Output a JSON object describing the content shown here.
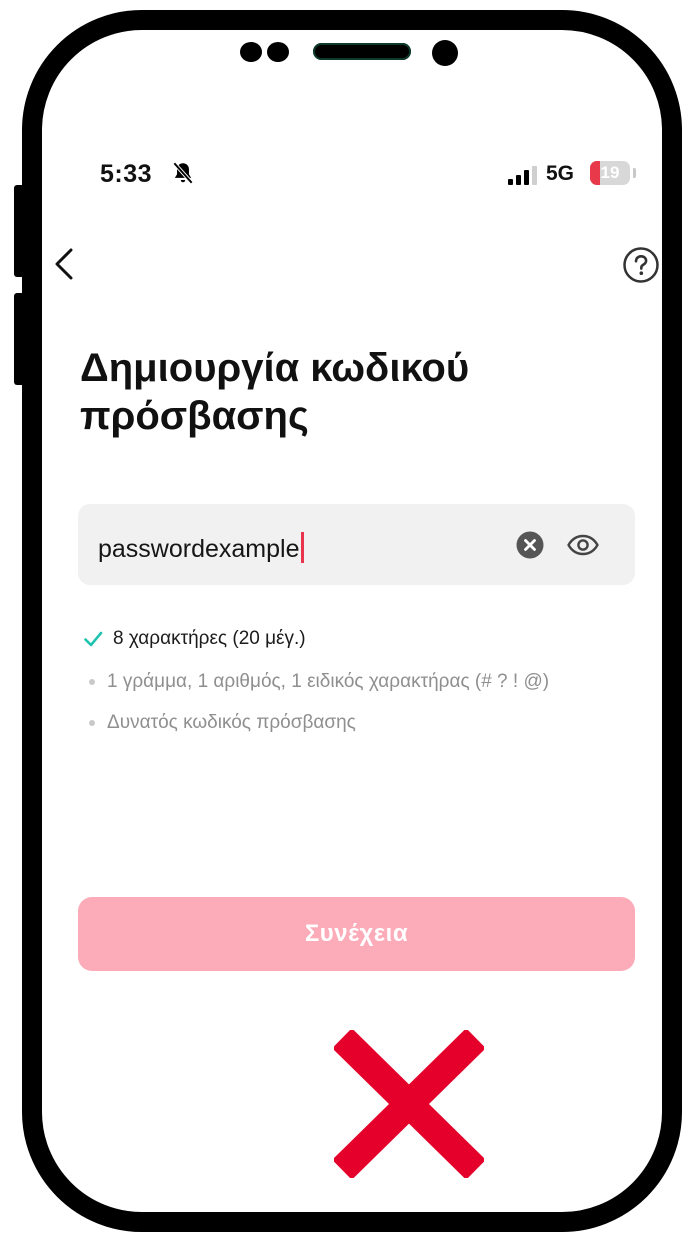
{
  "status_bar": {
    "time": "5:33",
    "network": "5G",
    "battery": "19"
  },
  "page": {
    "title": "Δημιουργία κωδικού πρόσβασης"
  },
  "password_field": {
    "value": "passwordexample"
  },
  "requirements": [
    {
      "text": "8 χαρακτήρες (20 μέγ.)",
      "met": true
    },
    {
      "text": "1 γράμμα, 1 αριθμός, 1 ειδικός χαρακτήρας (# ? ! @)",
      "met": false
    },
    {
      "text": "Δυνατός κωδικός πρόσβασης",
      "met": false
    }
  ],
  "continue_button": {
    "label": "Συνέχεια",
    "enabled": false
  },
  "colors": {
    "accent": "#fe2c55",
    "button_disabled": "#fcabb8",
    "check": "#20c3b0",
    "cross": "#e4002b"
  },
  "icons": [
    "bell-slash-icon",
    "signal-icon",
    "back-icon",
    "help-icon",
    "clear-icon",
    "eye-icon",
    "check-icon",
    "cross-icon"
  ]
}
